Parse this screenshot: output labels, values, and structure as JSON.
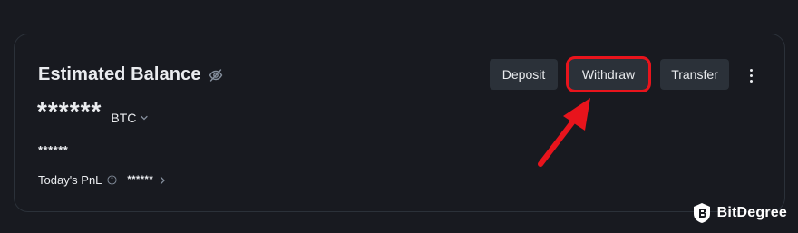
{
  "balance_card": {
    "title": "Estimated Balance",
    "hidden_balance": "******",
    "currency": "BTC",
    "hidden_fiat": "******",
    "pnl_label": "Today's PnL",
    "pnl_value": "******"
  },
  "actions": {
    "deposit_label": "Deposit",
    "withdraw_label": "Withdraw",
    "transfer_label": "Transfer"
  },
  "highlight": {
    "target": "Withdraw",
    "color": "#e8141c"
  },
  "icons": {
    "visibility": "eye-slash-icon",
    "currency_dropdown": "chevron-down-icon",
    "info": "info-icon",
    "pnl_detail": "chevron-right-icon",
    "more": "more-vertical-icon",
    "annotation": "red-arrow-icon",
    "brand": "bitdegree-logo-icon"
  },
  "watermark": {
    "text": "BitDegree"
  },
  "colors": {
    "background": "#181a20",
    "card_border": "#2b3139",
    "button_bg": "#2b3139",
    "text": "#eaecef"
  }
}
